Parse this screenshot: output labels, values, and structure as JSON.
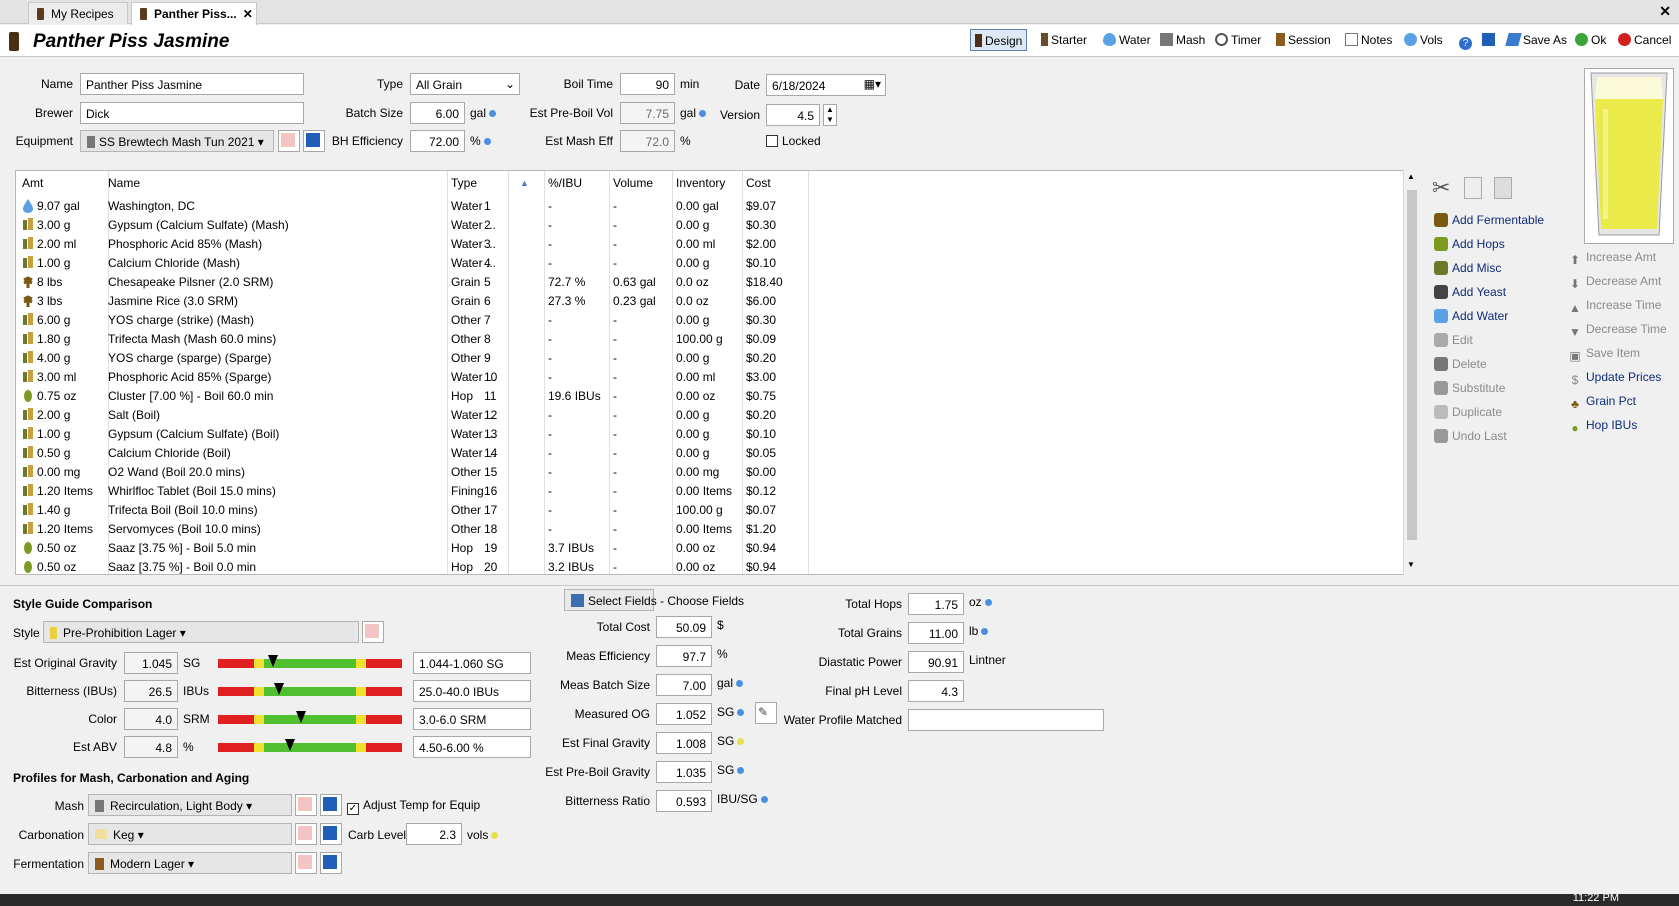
{
  "tabs": [
    {
      "label": "My Recipes"
    },
    {
      "label": "Panther Piss..."
    }
  ],
  "title": "Panther Piss Jasmine",
  "toolbar": [
    "Design",
    "Starter",
    "Water",
    "Mash",
    "Timer",
    "Session",
    "Notes",
    "Vols",
    "Save As",
    "Ok",
    "Cancel"
  ],
  "form": {
    "name_label": "Name",
    "name": "Panther Piss Jasmine",
    "brewer_label": "Brewer",
    "brewer": "Dick",
    "equipment_label": "Equipment",
    "equipment": "SS Brewtech Mash Tun 2021",
    "type_label": "Type",
    "type": "All Grain",
    "batch_label": "Batch Size",
    "batch": "6.00",
    "batch_unit": "gal",
    "bh_label": "BH Efficiency",
    "bh": "72.00",
    "bh_unit": "%",
    "boil_label": "Boil Time",
    "boil": "90",
    "boil_unit": "min",
    "preboil_label": "Est Pre-Boil Vol",
    "preboil": "7.75",
    "preboil_unit": "gal",
    "mash_eff_label": "Est Mash Eff",
    "mash_eff": "72.0",
    "mash_eff_unit": "%",
    "date_label": "Date",
    "date": "6/18/2024",
    "version_label": "Version",
    "version": "4.5",
    "locked_label": "Locked"
  },
  "table": {
    "headers": [
      "Amt",
      "Name",
      "Type",
      "%/IBU",
      "Volume",
      "Inventory",
      "Cost"
    ],
    "rows": [
      {
        "icon": "water",
        "amt": "9.07 gal",
        "name": "Washington, DC",
        "type": "Water",
        "num": "1",
        "pct": "-",
        "vol": "-",
        "inv": "0.00 gal",
        "cost": "$9.07"
      },
      {
        "icon": "misc",
        "amt": "3.00 g",
        "name": "Gypsum (Calcium Sulfate) (Mash)",
        "type": "Water ...",
        "num": "2",
        "pct": "-",
        "vol": "-",
        "inv": "0.00 g",
        "cost": "$0.30"
      },
      {
        "icon": "misc",
        "amt": "2.00 ml",
        "name": "Phosphoric Acid 85% (Mash)",
        "type": "Water ...",
        "num": "3",
        "pct": "-",
        "vol": "-",
        "inv": "0.00 ml",
        "cost": "$2.00"
      },
      {
        "icon": "misc",
        "amt": "1.00 g",
        "name": "Calcium Chloride (Mash)",
        "type": "Water ...",
        "num": "4",
        "pct": "-",
        "vol": "-",
        "inv": "0.00 g",
        "cost": "$0.10"
      },
      {
        "icon": "grain",
        "amt": "8 lbs",
        "name": "Chesapeake Pilsner (2.0 SRM)",
        "type": "Grain",
        "num": "5",
        "pct": "72.7 %",
        "vol": "0.63 gal",
        "inv": "0.0 oz",
        "cost": "$18.40"
      },
      {
        "icon": "grain",
        "amt": "3 lbs",
        "name": "Jasmine Rice (3.0 SRM)",
        "type": "Grain",
        "num": "6",
        "pct": "27.3 %",
        "vol": "0.23 gal",
        "inv": "0.0 oz",
        "cost": "$6.00"
      },
      {
        "icon": "misc",
        "amt": "6.00 g",
        "name": "YOS charge (strike) (Mash)",
        "type": "Other",
        "num": "7",
        "pct": "-",
        "vol": "-",
        "inv": "0.00 g",
        "cost": "$0.30"
      },
      {
        "icon": "misc",
        "amt": "1.80 g",
        "name": "Trifecta Mash (Mash 60.0 mins)",
        "type": "Other",
        "num": "8",
        "pct": "-",
        "vol": "-",
        "inv": "100.00 g",
        "cost": "$0.09"
      },
      {
        "icon": "misc",
        "amt": "4.00 g",
        "name": "YOS charge (sparge) (Sparge)",
        "type": "Other",
        "num": "9",
        "pct": "-",
        "vol": "-",
        "inv": "0.00 g",
        "cost": "$0.20"
      },
      {
        "icon": "misc",
        "amt": "3.00 ml",
        "name": "Phosphoric Acid 85% (Sparge)",
        "type": "Water ...",
        "num": "10",
        "pct": "-",
        "vol": "-",
        "inv": "0.00 ml",
        "cost": "$3.00"
      },
      {
        "icon": "hop",
        "amt": "0.75 oz",
        "name": "Cluster [7.00 %] - Boil 60.0 min",
        "type": "Hop",
        "num": "11",
        "pct": "19.6 IBUs",
        "vol": "-",
        "inv": "0.00 oz",
        "cost": "$0.75"
      },
      {
        "icon": "misc",
        "amt": "2.00 g",
        "name": "Salt (Boil)",
        "type": "Water ...",
        "num": "12",
        "pct": "-",
        "vol": "-",
        "inv": "0.00 g",
        "cost": "$0.20"
      },
      {
        "icon": "misc",
        "amt": "1.00 g",
        "name": "Gypsum (Calcium Sulfate) (Boil)",
        "type": "Water ...",
        "num": "13",
        "pct": "-",
        "vol": "-",
        "inv": "0.00 g",
        "cost": "$0.10"
      },
      {
        "icon": "misc",
        "amt": "0.50 g",
        "name": "Calcium Chloride (Boil)",
        "type": "Water ...",
        "num": "14",
        "pct": "-",
        "vol": "-",
        "inv": "0.00 g",
        "cost": "$0.05"
      },
      {
        "icon": "misc",
        "amt": "0.00 mg",
        "name": "O2 Wand (Boil 20.0 mins)",
        "type": "Other",
        "num": "15",
        "pct": "-",
        "vol": "-",
        "inv": "0.00 mg",
        "cost": "$0.00"
      },
      {
        "icon": "misc",
        "amt": "1.20 Items",
        "name": "Whirlfloc Tablet (Boil 15.0 mins)",
        "type": "Fining",
        "num": "16",
        "pct": "-",
        "vol": "-",
        "inv": "0.00 Items",
        "cost": "$0.12"
      },
      {
        "icon": "misc",
        "amt": "1.40 g",
        "name": "Trifecta Boil (Boil 10.0 mins)",
        "type": "Other",
        "num": "17",
        "pct": "-",
        "vol": "-",
        "inv": "100.00 g",
        "cost": "$0.07"
      },
      {
        "icon": "misc",
        "amt": "1.20 Items",
        "name": "Servomyces (Boil 10.0 mins)",
        "type": "Other",
        "num": "18",
        "pct": "-",
        "vol": "-",
        "inv": "0.00 Items",
        "cost": "$1.20"
      },
      {
        "icon": "hop",
        "amt": "0.50 oz",
        "name": "Saaz [3.75 %] - Boil 5.0 min",
        "type": "Hop",
        "num": "19",
        "pct": "3.7 IBUs",
        "vol": "-",
        "inv": "0.00 oz",
        "cost": "$0.94"
      },
      {
        "icon": "hop",
        "amt": "0.50 oz",
        "name": "Saaz [3.75 %] - Boil 0.0 min",
        "type": "Hop",
        "num": "20",
        "pct": "3.2 IBUs",
        "vol": "-",
        "inv": "0.00 oz",
        "cost": "$0.94"
      }
    ]
  },
  "side_actions": [
    "Add Fermentable",
    "Add Hops",
    "Add Misc",
    "Add Yeast",
    "Add Water",
    "Edit",
    "Delete",
    "Substitute",
    "Duplicate",
    "Undo Last"
  ],
  "right_actions": [
    "Increase Amt",
    "Decrease Amt",
    "Increase Time",
    "Decrease Time",
    "Save Item",
    "Update Prices",
    "Grain Pct",
    "Hop IBUs"
  ],
  "style": {
    "section": "Style Guide Comparison",
    "style_label": "Style",
    "style": "Pre-Prohibition Lager",
    "rows": [
      {
        "label": "Est Original Gravity",
        "value": "1.045",
        "unit": "SG",
        "range": "1.044-1.060 SG",
        "marker": 0.3
      },
      {
        "label": "Bitterness (IBUs)",
        "value": "26.5",
        "unit": "IBUs",
        "range": "25.0-40.0 IBUs",
        "marker": 0.33
      },
      {
        "label": "Color",
        "value": "4.0",
        "unit": "SRM",
        "range": "3.0-6.0 SRM",
        "marker": 0.45
      },
      {
        "label": "Est ABV",
        "value": "4.8",
        "unit": "%",
        "range": "4.50-6.00 %",
        "marker": 0.39
      }
    ]
  },
  "profiles": {
    "section": "Profiles for Mash, Carbonation and Aging",
    "mash_label": "Mash",
    "mash": "Recirculation, Light Body",
    "adjust_label": "Adjust Temp for Equip",
    "carb_label": "Carbonation",
    "carb": "Keg",
    "carb_level_label": "Carb Level",
    "carb_level": "2.3",
    "carb_unit": "vols",
    "ferm_label": "Fermentation",
    "ferm": "Modern Lager"
  },
  "stats": {
    "select_fields": "Select Fields",
    "choose_fields": "- Choose Fields",
    "rows": [
      {
        "label": "Total Cost",
        "value": "50.09",
        "unit": "$",
        "dot": ""
      },
      {
        "label": "Meas Efficiency",
        "value": "97.7",
        "unit": "%",
        "dot": ""
      },
      {
        "label": "Meas Batch Size",
        "value": "7.00",
        "unit": "gal",
        "dot": "b"
      },
      {
        "label": "Measured OG",
        "value": "1.052",
        "unit": "SG",
        "dot": "b"
      },
      {
        "label": "Est Final Gravity",
        "value": "1.008",
        "unit": "SG",
        "dot": "y"
      },
      {
        "label": "Est Pre-Boil Gravity",
        "value": "1.035",
        "unit": "SG",
        "dot": "b"
      },
      {
        "label": "Bitterness Ratio",
        "value": "0.593",
        "unit": "IBU/SG",
        "dot": "b"
      }
    ],
    "right": [
      {
        "label": "Total Hops",
        "value": "1.75",
        "unit": "oz",
        "dot": "b"
      },
      {
        "label": "Total Grains",
        "value": "11.00",
        "unit": "lb",
        "dot": "b"
      },
      {
        "label": "Diastatic Power",
        "value": "90.91",
        "unit": "Lintner",
        "dot": ""
      },
      {
        "label": "Final pH Level",
        "value": "4.3",
        "unit": "",
        "dot": ""
      },
      {
        "label": "Water Profile Matched",
        "value": "",
        "unit": "",
        "dot": ""
      }
    ]
  },
  "clock": "11:22 PM"
}
